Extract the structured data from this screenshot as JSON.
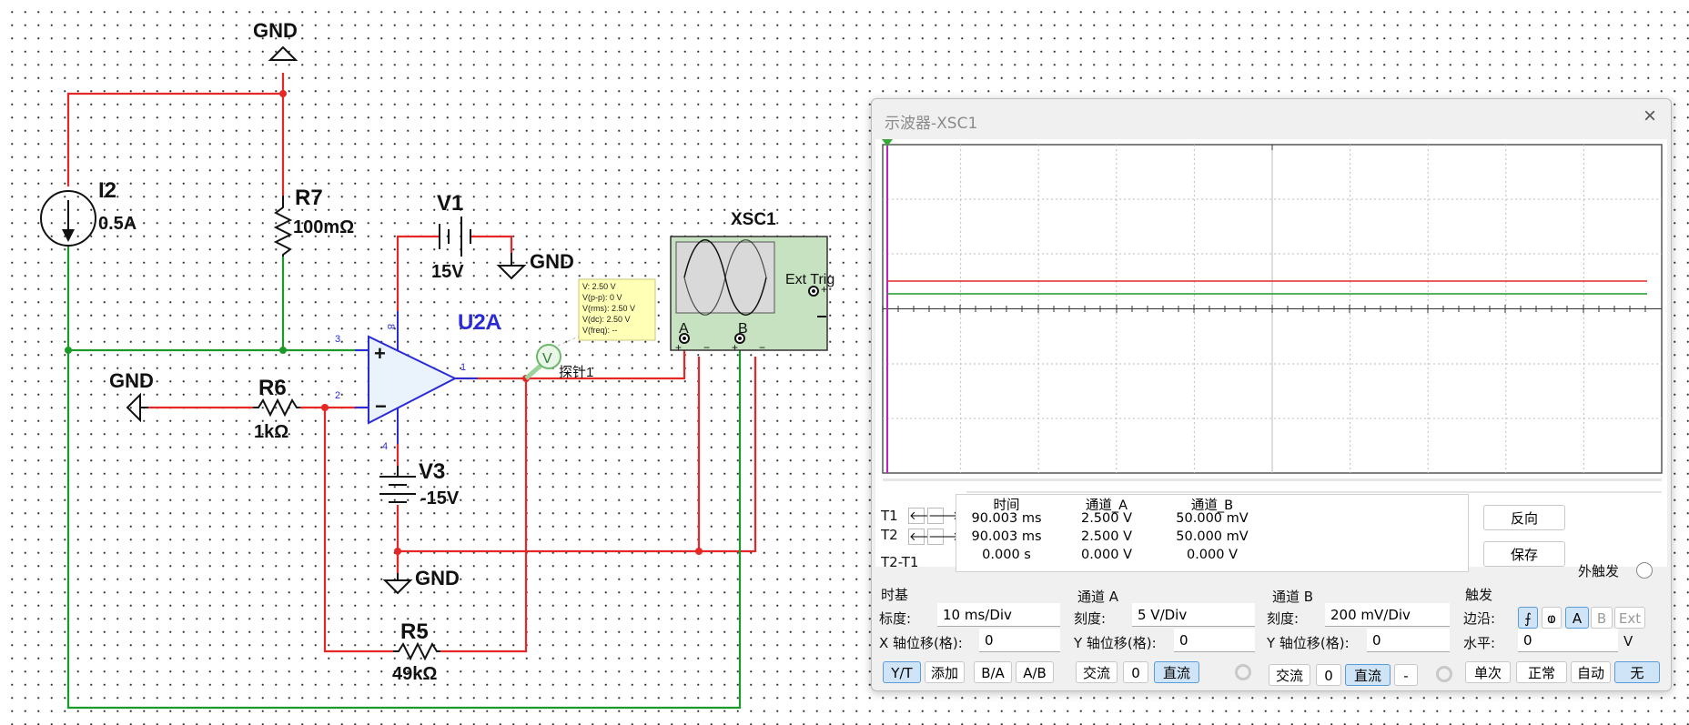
{
  "schematic": {
    "i2": {
      "name": "I2",
      "value": "0.5A"
    },
    "r7": {
      "name": "R7",
      "value": "100mΩ"
    },
    "v1": {
      "name": "V1",
      "value": "15V"
    },
    "u2a": {
      "name": "U2A"
    },
    "r6": {
      "name": "R6",
      "value": "1kΩ"
    },
    "v3": {
      "name": "V3",
      "value": "-15V"
    },
    "r5": {
      "name": "R5",
      "value": "49kΩ"
    },
    "xsc1": {
      "name": "XSC1",
      "ext_trig": "Ext Trig",
      "ch_a": "A",
      "ch_b": "B"
    },
    "gnd_label": "GND",
    "pins": {
      "in_plus": "3",
      "in_minus": "2",
      "out": "1",
      "vpos": "8",
      "vneg": "4"
    },
    "probe": {
      "name": "探针1",
      "symbol": "V",
      "readout": [
        "V: 2.50 V",
        "V(p-p): 0 V",
        "V(rms): 2.50 V",
        "V(dc): 2.50 V",
        "V(freq): --"
      ]
    }
  },
  "scope": {
    "title": "示波器-XSC1",
    "close_icon": "×",
    "colors": {
      "ch_a": "#e52727",
      "ch_b": "#1b9a2a",
      "cursor_t1": "#c020c0"
    },
    "measurements": {
      "headers": [
        "时间",
        "通道_A",
        "通道_B"
      ],
      "rows": [
        {
          "label": "T1",
          "time": "90.003 ms",
          "a": "2.500 V",
          "b": "50.000 mV"
        },
        {
          "label": "T2",
          "time": "90.003 ms",
          "a": "2.500 V",
          "b": "50.000 mV"
        },
        {
          "label": "T2-T1",
          "time": "0.000 s",
          "a": "0.000 V",
          "b": "0.000 V"
        }
      ]
    },
    "reverse_label": "反向",
    "save_label": "保存",
    "ext_trigger_label": "外触发",
    "timebase": {
      "title": "时基",
      "scale_label": "标度:",
      "scale": "10 ms/Div",
      "xpos_label": "X 轴位移(格):",
      "xpos": "0",
      "buttons": [
        "Y/T",
        "添加",
        "B/A",
        "A/B"
      ],
      "active": "Y/T"
    },
    "channel_a": {
      "title": "通道 A",
      "scale_label": "刻度:",
      "scale": "5  V/Div",
      "ypos_label": "Y 轴位移(格):",
      "ypos": "0",
      "ac": "交流",
      "zero": "0",
      "dc": "直流"
    },
    "channel_b": {
      "title": "通道 B",
      "scale_label": "刻度:",
      "scale": "200 mV/Div",
      "ypos_label": "Y 轴位移(格):",
      "ypos": "0",
      "ac": "交流",
      "zero": "0",
      "dc": "直流",
      "minus": "-"
    },
    "trigger": {
      "title": "触发",
      "edge_label": "边沿:",
      "rise": "⨍",
      "fall": "ⱷ",
      "src_a": "A",
      "src_b": "B",
      "src_ext": "Ext",
      "level_label": "水平:",
      "level": "0",
      "level_unit": "V",
      "modes": [
        "单次",
        "正常",
        "自动",
        "无"
      ],
      "active_mode": "无"
    }
  }
}
